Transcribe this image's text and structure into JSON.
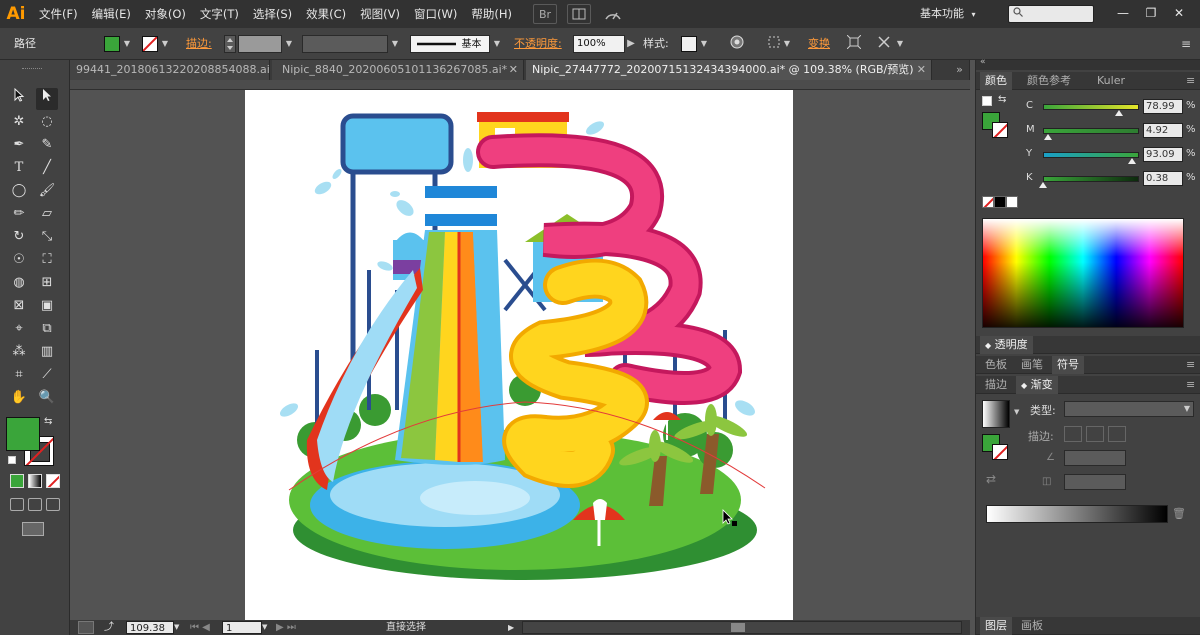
{
  "app": {
    "logo": "Ai"
  },
  "menu": [
    "文件(F)",
    "编辑(E)",
    "对象(O)",
    "文字(T)",
    "选择(S)",
    "效果(C)",
    "视图(V)",
    "窗口(W)",
    "帮助(H)"
  ],
  "menubar_icons": {
    "bridge": "Br"
  },
  "workspace": {
    "label": "基本功能",
    "chevron": "▾"
  },
  "search": {
    "value": "",
    "icon": "search-icon"
  },
  "window_controls": {
    "minimize": "—",
    "restore": "❐",
    "close": "✕"
  },
  "control_bar": {
    "object_type": "路径",
    "fill_color": "#3aa53a",
    "stroke_label": "描边:",
    "stroke_profile": "基本",
    "opacity_label": "不透明度:",
    "opacity_value": "100%",
    "style_label": "样式:",
    "transform_label": "变换"
  },
  "tabs": [
    {
      "title": "99441_20180613220208854088.ai*",
      "active": false
    },
    {
      "title": "Nipic_8840_20200605101136267085.ai*",
      "active": false
    },
    {
      "title": "Nipic_27447772_20200715132434394000.ai* @ 109.38% (RGB/预览)",
      "active": true
    }
  ],
  "tab_close": "✕",
  "toolbar": {
    "fill_color": "#3aa53a",
    "tools": [
      "selection-tool",
      "direct-selection-tool",
      "magic-wand-tool",
      "lasso-tool",
      "pen-tool",
      "curvature-tool",
      "type-tool",
      "line-tool",
      "ellipse-tool",
      "paintbrush-tool",
      "pencil-tool",
      "eraser-tool",
      "rotate-tool",
      "scale-tool",
      "warp-tool",
      "free-transform-tool",
      "shape-builder-tool",
      "perspective-tool",
      "mesh-tool",
      "gradient-tool",
      "eyedropper-tool",
      "blend-tool",
      "symbol-sprayer-tool",
      "column-graph-tool",
      "artboard-tool",
      "slice-tool",
      "hand-tool",
      "zoom-tool"
    ]
  },
  "status_bar": {
    "zoom": "109.38",
    "page": "1",
    "tool_name": "直接选择"
  },
  "color_panel": {
    "tabs": [
      "颜色",
      "颜色参考",
      "Kuler"
    ],
    "fill_color": "#3aa53a",
    "channels": [
      {
        "label": "C",
        "value": "78.99",
        "pos": 0.79,
        "track": "linear-gradient(90deg,#3aa53a,#e5e52a)"
      },
      {
        "label": "M",
        "value": "4.92",
        "pos": 0.05,
        "track": "linear-gradient(90deg,#3aa53a,#2e7d31)"
      },
      {
        "label": "Y",
        "value": "93.09",
        "pos": 0.93,
        "track": "linear-gradient(90deg,#1aa0c8,#3aa53a)"
      },
      {
        "label": "K",
        "value": "0.38",
        "pos": 0.004,
        "track": "linear-gradient(90deg,#3aa53a,#0d2a0d)"
      }
    ],
    "percent": "%"
  },
  "transparency_panel": {
    "title": "透明度"
  },
  "swatch_tabs": [
    "色板",
    "画笔",
    "符号"
  ],
  "gradient_panel": {
    "tabs": [
      "描边",
      "渐变"
    ],
    "type_label": "类型:",
    "stroke_label": "描边:"
  },
  "layers_tabs": [
    "图层",
    "画板"
  ],
  "artwork_colors": {
    "green": "#3fae3a",
    "pink": "#ef3f7f",
    "yellow": "#ffd51e",
    "blue": "#5bc2ee",
    "navy": "#2a4d8f",
    "orange": "#ff8b1a",
    "red": "#e2341d",
    "purple": "#7b3fa0"
  }
}
